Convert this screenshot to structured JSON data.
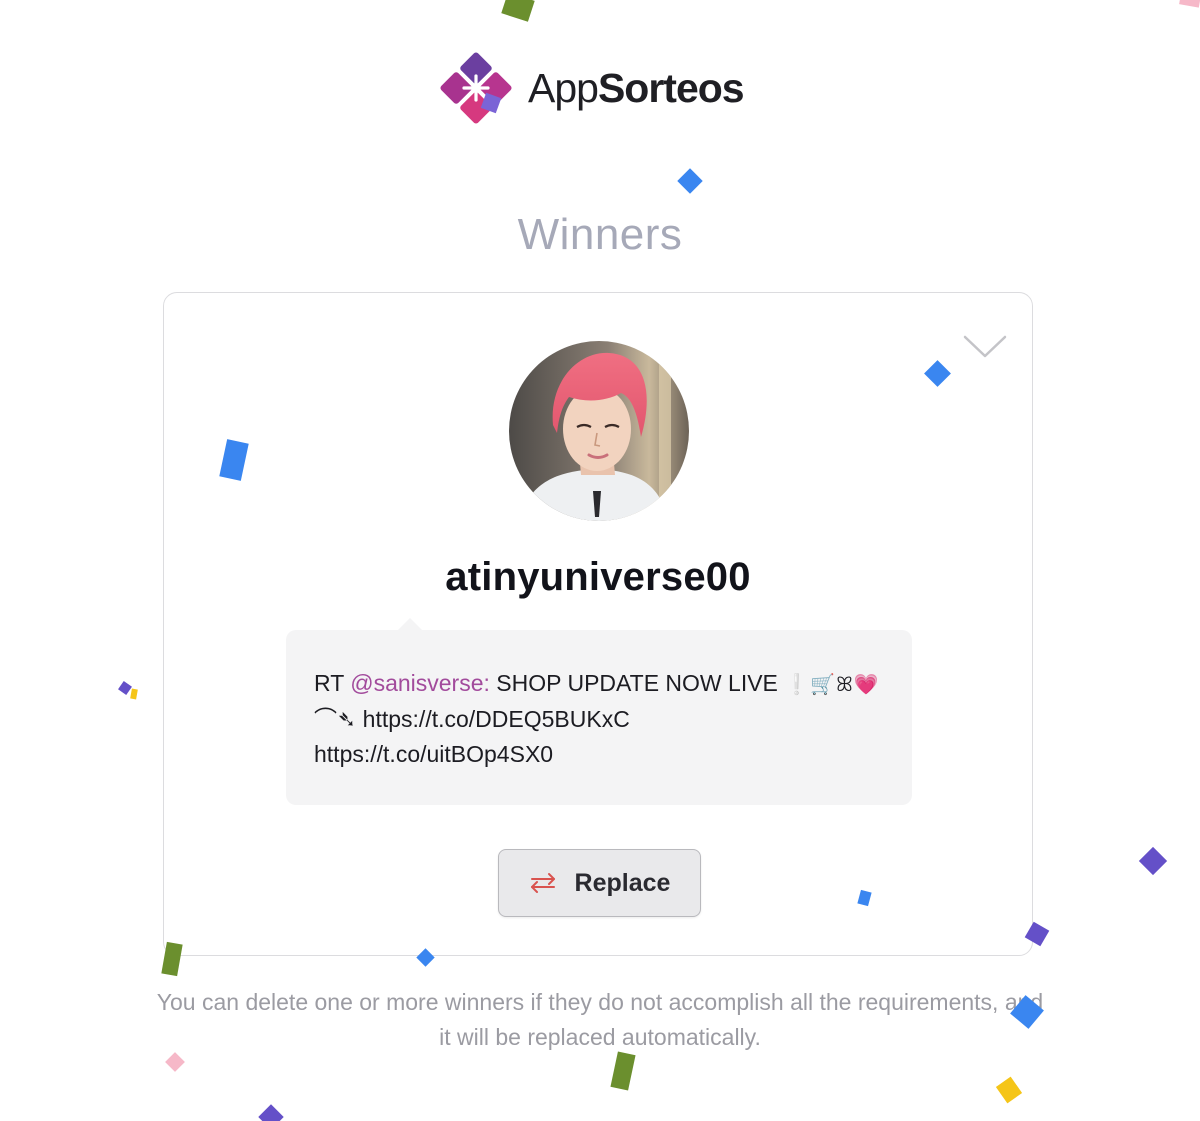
{
  "brand": {
    "name_light": "App",
    "name_bold": "Sorteos",
    "logo_icon": "appsorteos-diamond-logo"
  },
  "section": {
    "title": "Winners"
  },
  "winner": {
    "username": "atinyuniverse00",
    "avatar_icon": "profile-photo",
    "tweet": {
      "prefix": "RT ",
      "mention": "@sanisverse:",
      "text_line1": " SHOP UPDATE NOW LIVE ",
      "emojis": "❕🛒ꕤ💗",
      "line2_prefix": "⌒➴ ",
      "link1": "https://t.co/DDEQ5BUKxC",
      "link2": "https://t.co/uitBOp4SX0"
    },
    "replace_button": {
      "label": "Replace",
      "icon": "swap-arrows-icon"
    },
    "collapse_icon": "chevron-down-icon"
  },
  "footer": {
    "note": "You can delete one or more winners if they do not accomplish all the requirements, and it will be replaced automatically."
  },
  "colors": {
    "title_gray": "#a6a9b8",
    "mention_purple": "#a24b9c",
    "replace_icon_red": "#d9534f",
    "logo_magenta": "#a8338f",
    "logo_purple": "#6b3fa0",
    "confetti_blue": "#3a86f0",
    "confetti_green": "#6b8f2e",
    "confetti_purple": "#6450c8",
    "confetti_yellow": "#f5c518",
    "confetti_pink": "#f6b8c8"
  }
}
